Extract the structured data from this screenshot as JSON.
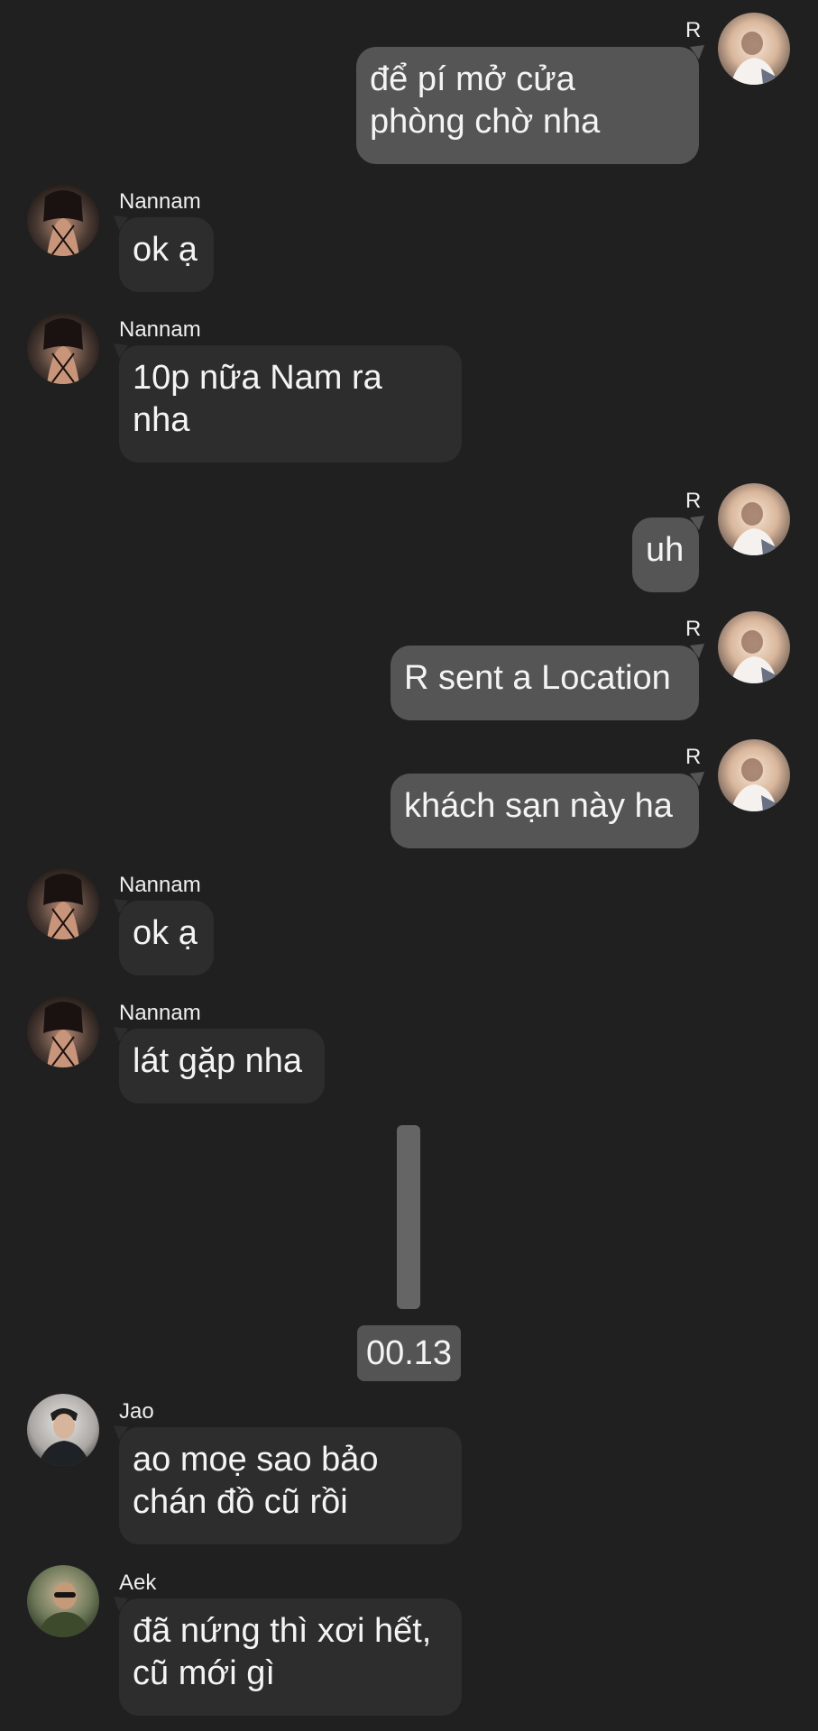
{
  "messages": [
    {
      "sender": "R",
      "text": "để pí mở cửa\nphòng chờ nha"
    },
    {
      "sender": "Nannam",
      "text": "ok ạ"
    },
    {
      "sender": "Nannam",
      "text": "10p nữa Nam ra\nnha"
    },
    {
      "sender": "R",
      "text": "uh"
    },
    {
      "sender": "R",
      "text": "R sent a Location"
    },
    {
      "sender": "R",
      "text": "khách sạn này ha"
    },
    {
      "sender": "Nannam",
      "text": "ok ạ"
    },
    {
      "sender": "Nannam",
      "text": "lát gặp nha"
    },
    {
      "sender": "Jao",
      "text": "ao moẹ sao bảo\nchán đồ cũ rồi"
    },
    {
      "sender": "Aek",
      "text": "đã nứng thì xơi hết,\ncũ mới gì"
    }
  ],
  "timestamp": "00.13",
  "colors": {
    "background": "#202020",
    "incoming_bubble": "#2d2d2d",
    "outgoing_bubble": "#555555",
    "text": "#f4f4f4"
  }
}
